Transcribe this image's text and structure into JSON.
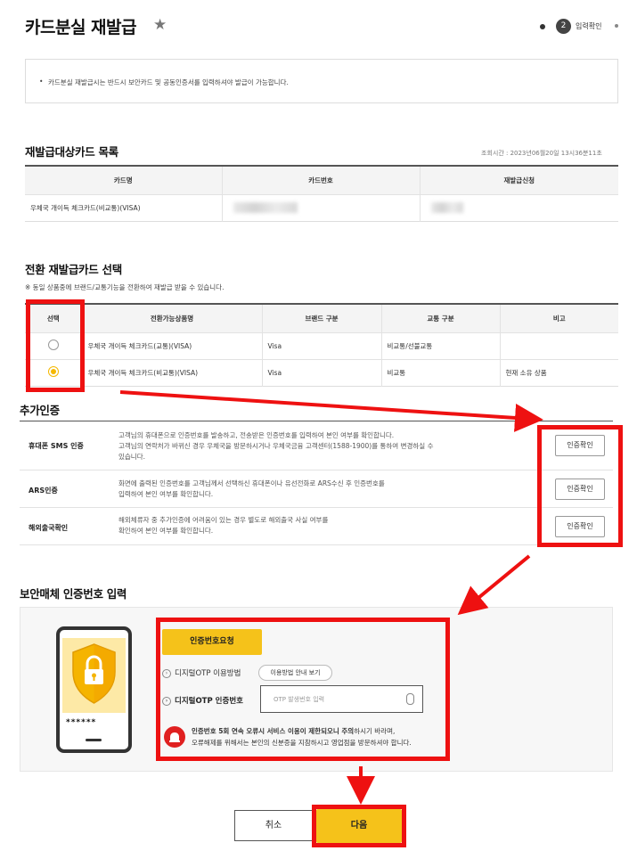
{
  "page": {
    "title": "카드분실 재발급",
    "step_number": "2",
    "step_label": "입력확인"
  },
  "notice": {
    "bullet": "•",
    "text": "카드분실 재발급시는 반드시 보안카드 및 공동인증서를 입력하셔야 발급이 가능합니다."
  },
  "target_cards": {
    "heading": "재발급대상카드 목록",
    "lookup_time": "조회시간 : 2023년06월20일 13시36분11초",
    "columns": [
      "카드명",
      "카드번호",
      "재발급신청"
    ],
    "rows": [
      {
        "card_name": "우체국 개이득 체크카드(비교통)(VISA)"
      }
    ]
  },
  "convert_cards": {
    "heading": "전환 재발급카드 선택",
    "note": "※ 동일 상품중에 브랜드/교통기능을 전환하여 재발급 받을 수 있습니다.",
    "columns": [
      "선택",
      "전환가능상품명",
      "브랜드 구분",
      "교통 구분",
      "비고"
    ],
    "rows": [
      {
        "selected": false,
        "product": "우체국 개이득 체크카드(교통)(VISA)",
        "brand": "Visa",
        "transit": "비교통/선불교통",
        "note": ""
      },
      {
        "selected": true,
        "product": "우체국 개이득 체크카드(비교통)(VISA)",
        "brand": "Visa",
        "transit": "비교통",
        "note": "현재 소유 상품"
      }
    ]
  },
  "extra_auth": {
    "heading": "추가인증",
    "items": [
      {
        "name": "휴대폰 SMS 인증",
        "desc": [
          "고객님의 휴대폰으로 인증번호를 발송하고, 전송받은 인증번호를 입력하여 본인 여부를 확인합니다.",
          "고객님의 연락처가 바뀌신 경우 우체국을 방문하시거나 우체국금융 고객센터(1588-1900)를 통하여 변경하실 수",
          "있습니다."
        ],
        "button": "인증확인"
      },
      {
        "name": "ARS인증",
        "desc": [
          "화면에 출력된 인증번호를 고객님께서 선택하신 휴대폰이나 유선전화로 ARS수신 후 인증번호를",
          "입력하여 본인 여부를 확인합니다."
        ],
        "button": "인증확인"
      },
      {
        "name": "해외출국확인",
        "desc": [
          "해외체류자 중 추가인증에 어려움이 있는 경우 별도로 해외출국 사실 여부를",
          "확인하여 본인 여부를 확인합니다."
        ],
        "button": "인증확인"
      }
    ]
  },
  "security": {
    "heading": "보안매체 인증번호 입력",
    "phone_password": "******",
    "request_button": "인증번호요청",
    "otp_howto_label": "디지털OTP 이용방법",
    "otp_howto_button": "이용방법 안내 보기",
    "otp_code_label": "디지털OTP 인증번호",
    "otp_placeholder": "OTP 발생번호 입력",
    "warning_bold": "인증번호 5회 연속 오류시 서비스 이용이 제한되오니 주의",
    "warning_rest": "하시기 바라며,",
    "warning_line2": "오류해제를 위해서는 본인의 신분증을 지참하시고 영업점을 방문하셔야 합니다."
  },
  "actions": {
    "cancel": "취소",
    "next": "다음"
  },
  "colors": {
    "accent": "#f5c21a",
    "highlight": "#ee1111"
  }
}
